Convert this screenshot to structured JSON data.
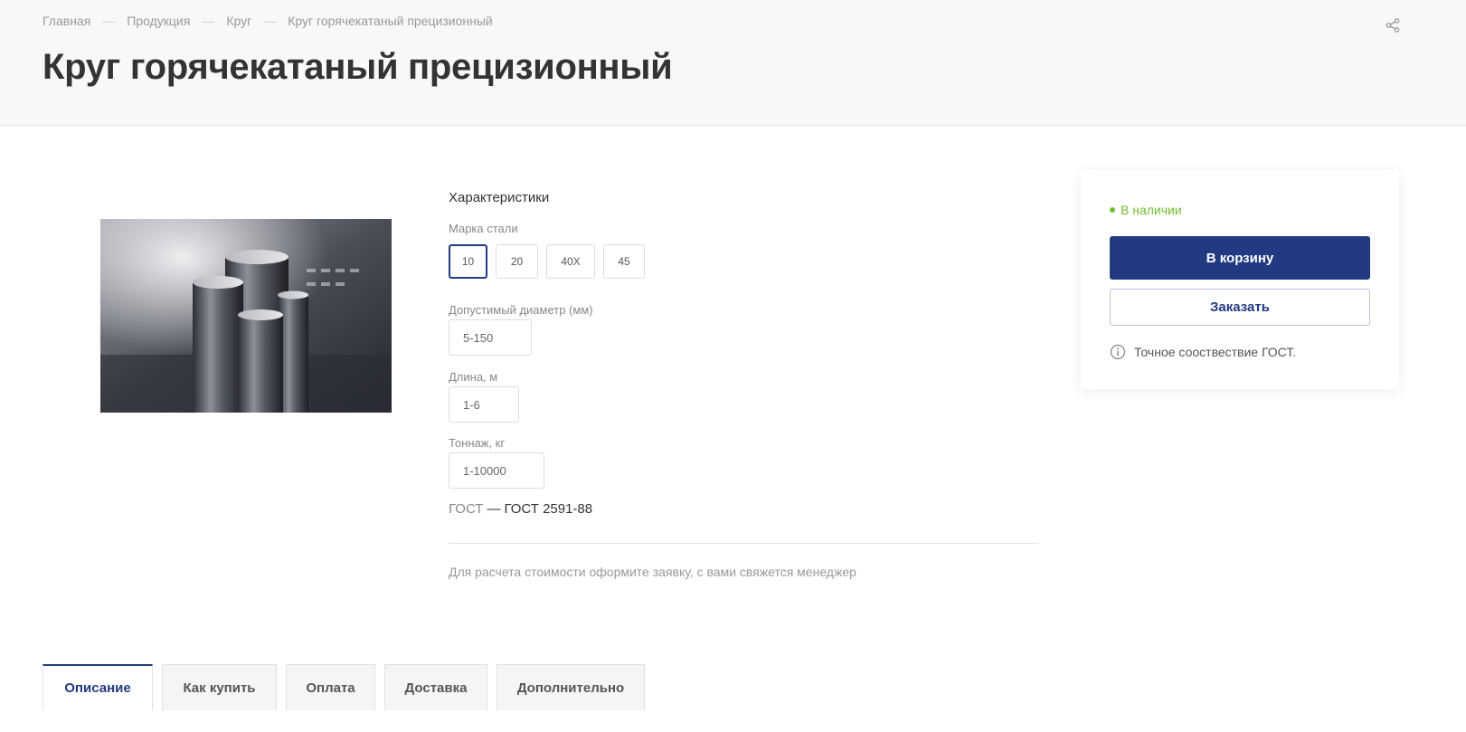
{
  "breadcrumb": {
    "items": [
      "Главная",
      "Продукция",
      "Круг",
      "Круг горячекатаный прецизионный"
    ],
    "separator": "—"
  },
  "page_title": "Круг горячекатаный прецизионный",
  "share_icon": "share-icon",
  "product": {
    "image_icon": "steel-rods-image"
  },
  "characteristics": {
    "title": "Характеристики",
    "grade_label": "Марка стали",
    "grades": [
      "10",
      "20",
      "40Х",
      "45"
    ],
    "selected_grade": "10",
    "diameter_label": "Допустимый диаметр (мм)",
    "diameter_value": "5-150",
    "length_label": "Длина, м",
    "length_value": "1-6",
    "tonnage_label": "Тоннаж, кг",
    "tonnage_value": "1-10000",
    "gost_name": "ГОСТ",
    "gost_dash": "—",
    "gost_value": "ГОСТ 2591-88",
    "calc_note": "Для расчета стоимости оформите заявку, с вами свяжется менеджер"
  },
  "buy_card": {
    "stock_status": "В наличии",
    "cart_label": "В корзину",
    "order_label": "Заказать",
    "gost_compliance": "Точное сооствествие ГОСТ.",
    "info_icon": "info-icon"
  },
  "tabs": [
    {
      "label": "Описание",
      "active": true
    },
    {
      "label": "Как купить",
      "active": false
    },
    {
      "label": "Оплата",
      "active": false
    },
    {
      "label": "Доставка",
      "active": false
    },
    {
      "label": "Дополнительно",
      "active": false
    }
  ],
  "colors": {
    "accent": "#213a82",
    "in_stock": "#6ebe2e",
    "header_bg": "#f8f8f8"
  }
}
